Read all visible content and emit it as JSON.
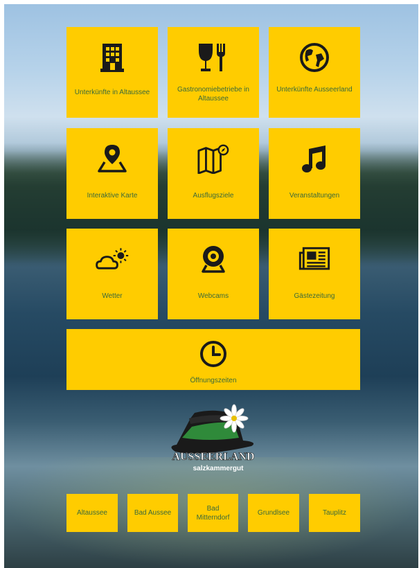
{
  "tiles": [
    {
      "label": "Unterkünfte in Altaussee",
      "icon": "building-icon"
    },
    {
      "label": "Gastronomiebetriebe in Altaussee",
      "icon": "dining-icon"
    },
    {
      "label": "Unterkünfte Ausseerland",
      "icon": "globe-icon"
    },
    {
      "label": "Interaktive Karte",
      "icon": "map-pin-icon"
    },
    {
      "label": "Ausflugsziele",
      "icon": "map-compass-icon"
    },
    {
      "label": "Veranstaltungen",
      "icon": "music-note-icon"
    },
    {
      "label": "Wetter",
      "icon": "weather-icon"
    },
    {
      "label": "Webcams",
      "icon": "webcam-icon"
    },
    {
      "label": "Gästezeitung",
      "icon": "newspaper-icon"
    },
    {
      "label": "Öffnungszeiten",
      "icon": "clock-icon"
    }
  ],
  "logo": {
    "line1": "AUSSEERLAND",
    "line2": "salzkammergut"
  },
  "towns": [
    "Altaussee",
    "Bad Aussee",
    "Bad Mitterndorf",
    "Grundlsee",
    "Tauplitz"
  ],
  "colors": {
    "tile": "#ffcc00",
    "label": "#3a6a3a",
    "icon": "#1a1a1a"
  }
}
